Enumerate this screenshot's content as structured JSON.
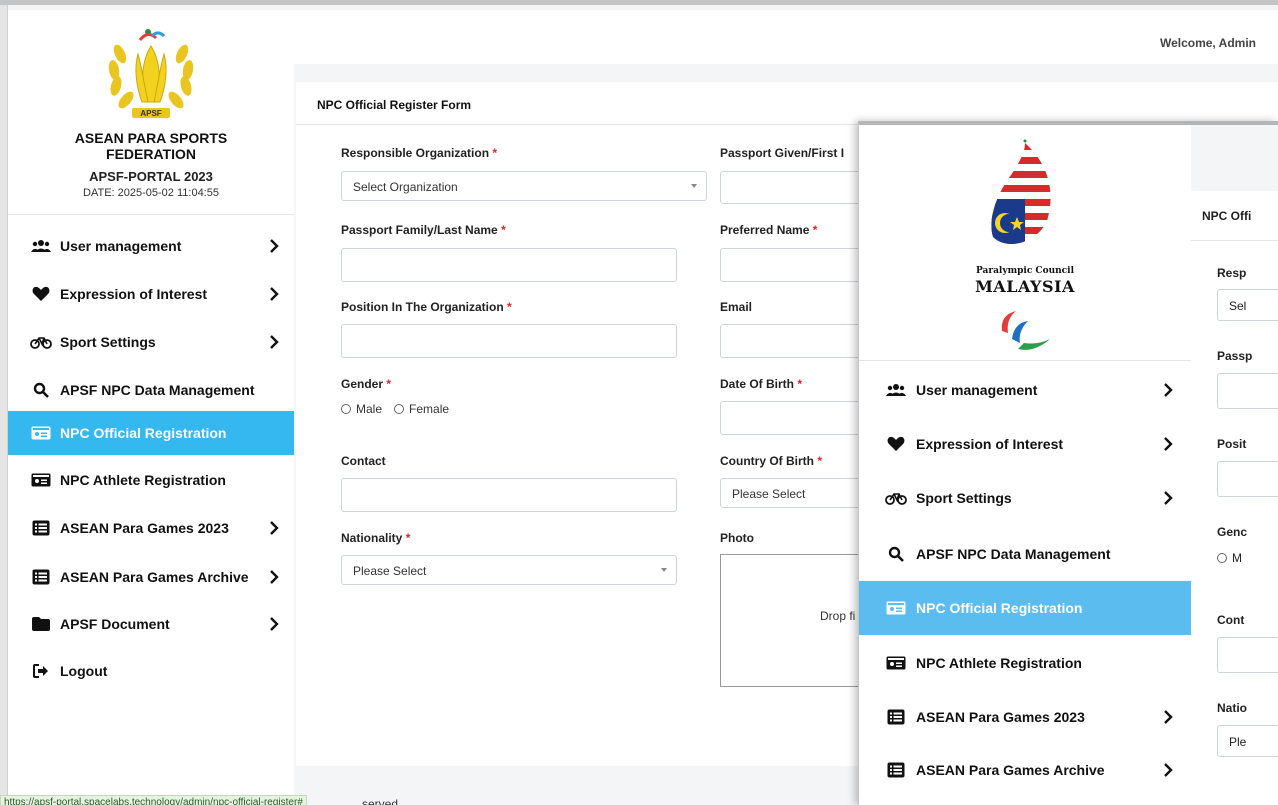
{
  "brand": {
    "logo_text": "APSF",
    "federation": "ASEAN PARA SPORTS FEDERATION",
    "portal": "APSF-PORTAL 2023",
    "date": "DATE: 2025-05-02 11:04:55"
  },
  "header": {
    "welcome": "Welcome, Admin"
  },
  "sidebar": {
    "items": [
      {
        "label": "User management",
        "icon": "users-icon",
        "has_submenu": true
      },
      {
        "label": "Expression of Interest",
        "icon": "heart-icon",
        "has_submenu": true
      },
      {
        "label": "Sport Settings",
        "icon": "bicycle-icon",
        "has_submenu": true
      },
      {
        "label": "APSF NPC Data Management",
        "icon": "search-icon",
        "has_submenu": false
      },
      {
        "label": "NPC Official Registration",
        "icon": "id-card-icon",
        "has_submenu": false,
        "active": true
      },
      {
        "label": "NPC Athlete Registration",
        "icon": "id-card-icon",
        "has_submenu": false
      },
      {
        "label": "ASEAN Para Games 2023",
        "icon": "list-icon",
        "has_submenu": true
      },
      {
        "label": "ASEAN Para Games Archive",
        "icon": "list-icon",
        "has_submenu": true
      },
      {
        "label": "APSF Document",
        "icon": "folder-icon",
        "has_submenu": true
      },
      {
        "label": "Logout",
        "icon": "sign-out-icon",
        "has_submenu": false
      }
    ]
  },
  "form": {
    "title": "NPC Official Register Form",
    "responsible_org": {
      "label": "Responsible Organization",
      "required": "*",
      "value": "Select Organization"
    },
    "passport_given": {
      "label": "Passport Given/First I",
      "required": ""
    },
    "passport_family": {
      "label": "Passport Family/Last Name",
      "required": "*"
    },
    "preferred_name": {
      "label": "Preferred Name",
      "required": "*"
    },
    "position": {
      "label": "Position In The Organization",
      "required": "*"
    },
    "email": {
      "label": "Email"
    },
    "gender": {
      "label": "Gender",
      "required": "*",
      "options": [
        "Male",
        "Female"
      ]
    },
    "dob": {
      "label": "Date Of Birth",
      "required": "*"
    },
    "contact": {
      "label": "Contact"
    },
    "country_of_birth": {
      "label": "Country Of Birth",
      "required": "*",
      "value": "Please Select"
    },
    "nationality": {
      "label": "Nationality",
      "required": "*",
      "value": "Please Select"
    },
    "photo": {
      "label": "Photo",
      "drop_text": "Drop fi"
    }
  },
  "status_bar": {
    "url": "https://apsf-portal.spacelabs.technology/admin/npc-official-register#",
    "footer_tail": "served."
  },
  "overlay": {
    "org_small": "Paralympic Council",
    "org_big": "MALAYSIA",
    "card_title": "NPC Offi",
    "labels": [
      "Resp",
      "Passp",
      "Posit",
      "Genc",
      "Cont",
      "Natio"
    ],
    "select_values": [
      "Sel",
      "Ple"
    ],
    "radio_text": "M",
    "sidebar_items": [
      {
        "label": "User management",
        "icon": "users-icon",
        "has_submenu": true
      },
      {
        "label": "Expression of Interest",
        "icon": "heart-icon",
        "has_submenu": true
      },
      {
        "label": "Sport Settings",
        "icon": "bicycle-icon",
        "has_submenu": true
      },
      {
        "label": "APSF NPC Data Management",
        "icon": "search-icon",
        "has_submenu": false
      },
      {
        "label": "NPC Official Registration",
        "icon": "id-card-icon",
        "has_submenu": false,
        "active": true
      },
      {
        "label": "NPC Athlete Registration",
        "icon": "id-card-icon",
        "has_submenu": false
      },
      {
        "label": "ASEAN Para Games 2023",
        "icon": "list-icon",
        "has_submenu": true
      },
      {
        "label": "ASEAN Para Games Archive",
        "icon": "list-icon",
        "has_submenu": true
      }
    ]
  },
  "colors": {
    "active_item": "#35b7f0",
    "overlay_active_item": "#5bbcf0",
    "required_mark": "#e02424",
    "page_bg": "#f4f5f7"
  }
}
